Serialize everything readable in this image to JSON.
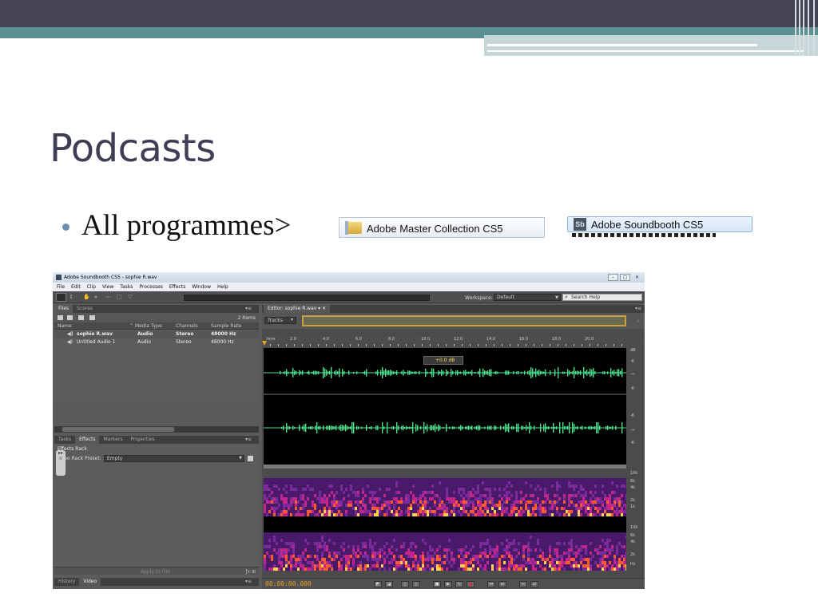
{
  "slide": {
    "title": "Podcasts",
    "bullet": "All programmes>",
    "menu_item_1": "Adobe Master Collection CS5",
    "menu_item_2": "Adobe Soundbooth CS5",
    "menu_item_2_icon": "Sb"
  },
  "app": {
    "window_title": "Adobe Soundbooth CS5 - sophie R.wav",
    "menu": [
      "File",
      "Edit",
      "Clip",
      "View",
      "Tasks",
      "Processes",
      "Effects",
      "Window",
      "Help"
    ],
    "workspace_label": "Workspace:",
    "workspace_value": "Default",
    "search_placeholder": "Search Help"
  },
  "files_panel": {
    "tabs": [
      "Files",
      "Scores"
    ],
    "item_count": "2 Items",
    "columns": [
      "Name",
      "Media Type",
      "Channels",
      "Sample Rate"
    ],
    "rows": [
      {
        "name": "sophie R.wav",
        "type": "Audio",
        "channels": "Stereo",
        "rate": "48000 Hz"
      },
      {
        "name": "Untitled Audio 1",
        "type": "Audio",
        "channels": "Stereo",
        "rate": "48000 Hz"
      }
    ]
  },
  "effects_panel": {
    "tabs": [
      "Tasks",
      "Effects",
      "Markers",
      "Properties"
    ],
    "rack_title": "Effects Rack",
    "preset_label": "reo Rack Preset:",
    "preset_value": "Empty",
    "apply_label": "Apply to File"
  },
  "bottom_tabs": [
    "History",
    "Video"
  ],
  "editor": {
    "tab_label": "Editor: sophie R.wav",
    "tracks_label": "Tracks",
    "ruler_start": "hms",
    "ruler_ticks": [
      "2.0",
      "4.0",
      "6.0",
      "8.0",
      "10.0",
      "12.0",
      "14.0",
      "16.0",
      "18.0",
      "20.0"
    ],
    "volume_hud": "+0.0 dB",
    "db_labels": [
      "dB",
      "-6",
      "-∞",
      "-6",
      "-6",
      "-∞",
      "-6"
    ],
    "freq_labels": [
      "10k",
      "6k",
      "4k",
      "2k",
      "1k",
      "10k",
      "6k",
      "4k",
      "2k",
      "Hz"
    ],
    "timecode": "00:00:00.000"
  },
  "colors": {
    "waveform": "#4ee08e",
    "timecode": "#e8a020",
    "slide_dark": "#444455",
    "slide_teal": "#5b8f92"
  }
}
